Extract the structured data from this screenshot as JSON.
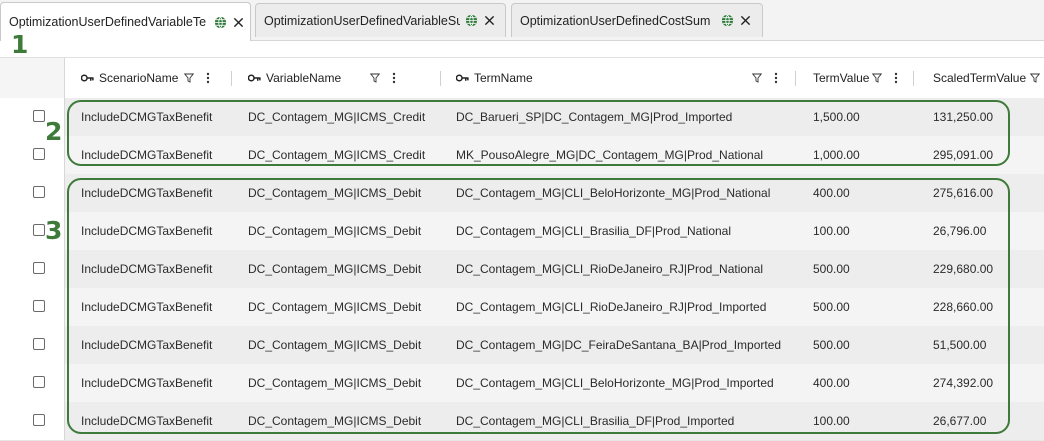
{
  "tabs": [
    {
      "label": "OptimizationUserDefinedVariableTe",
      "active": true
    },
    {
      "label": "OptimizationUserDefinedVariableSu",
      "active": false
    },
    {
      "label": "OptimizationUserDefinedCostSum",
      "active": false
    }
  ],
  "columns": [
    {
      "label": "ScenarioName",
      "key_icon": true,
      "menu": true
    },
    {
      "label": "VariableName",
      "key_icon": true,
      "menu": true
    },
    {
      "label": "TermName",
      "key_icon": true,
      "menu": true
    },
    {
      "label": "TermValue",
      "key_icon": false,
      "menu": true
    },
    {
      "label": "ScaledTermValue",
      "key_icon": false,
      "menu": false
    }
  ],
  "rows": [
    {
      "scenario": "IncludeDCMGTaxBenefit",
      "variable": "DC_Contagem_MG|ICMS_Credit",
      "term": "DC_Barueri_SP|DC_Contagem_MG|Prod_Imported",
      "value": "1,500.00",
      "scaled": "131,250.00"
    },
    {
      "scenario": "IncludeDCMGTaxBenefit",
      "variable": "DC_Contagem_MG|ICMS_Credit",
      "term": "MK_PousoAlegre_MG|DC_Contagem_MG|Prod_National",
      "value": "1,000.00",
      "scaled": "295,091.00"
    },
    {
      "scenario": "IncludeDCMGTaxBenefit",
      "variable": "DC_Contagem_MG|ICMS_Debit",
      "term": "DC_Contagem_MG|CLI_BeloHorizonte_MG|Prod_National",
      "value": "400.00",
      "scaled": "275,616.00"
    },
    {
      "scenario": "IncludeDCMGTaxBenefit",
      "variable": "DC_Contagem_MG|ICMS_Debit",
      "term": "DC_Contagem_MG|CLI_Brasilia_DF|Prod_National",
      "value": "100.00",
      "scaled": "26,796.00"
    },
    {
      "scenario": "IncludeDCMGTaxBenefit",
      "variable": "DC_Contagem_MG|ICMS_Debit",
      "term": "DC_Contagem_MG|CLI_RioDeJaneiro_RJ|Prod_National",
      "value": "500.00",
      "scaled": "229,680.00"
    },
    {
      "scenario": "IncludeDCMGTaxBenefit",
      "variable": "DC_Contagem_MG|ICMS_Debit",
      "term": "DC_Contagem_MG|CLI_RioDeJaneiro_RJ|Prod_Imported",
      "value": "500.00",
      "scaled": "228,660.00"
    },
    {
      "scenario": "IncludeDCMGTaxBenefit",
      "variable": "DC_Contagem_MG|ICMS_Debit",
      "term": "DC_Contagem_MG|DC_FeiraDeSantana_BA|Prod_Imported",
      "value": "500.00",
      "scaled": "51,500.00"
    },
    {
      "scenario": "IncludeDCMGTaxBenefit",
      "variable": "DC_Contagem_MG|ICMS_Debit",
      "term": "DC_Contagem_MG|CLI_BeloHorizonte_MG|Prod_Imported",
      "value": "400.00",
      "scaled": "274,392.00"
    },
    {
      "scenario": "IncludeDCMGTaxBenefit",
      "variable": "DC_Contagem_MG|ICMS_Debit",
      "term": "DC_Contagem_MG|CLI_Brasilia_DF|Prod_Imported",
      "value": "100.00",
      "scaled": "26,677.00"
    }
  ],
  "annotations": {
    "one": "1",
    "two": "2",
    "three": "3"
  },
  "icons": {
    "tab_globe": "globe-icon",
    "tab_close": "close-icon",
    "key": "key-icon",
    "filter": "filter-icon",
    "menu": "kebab-menu-icon"
  },
  "colors": {
    "annotation": "#3e7b3a",
    "active_tab": "#ffffff",
    "row_alt": "#ededed"
  }
}
